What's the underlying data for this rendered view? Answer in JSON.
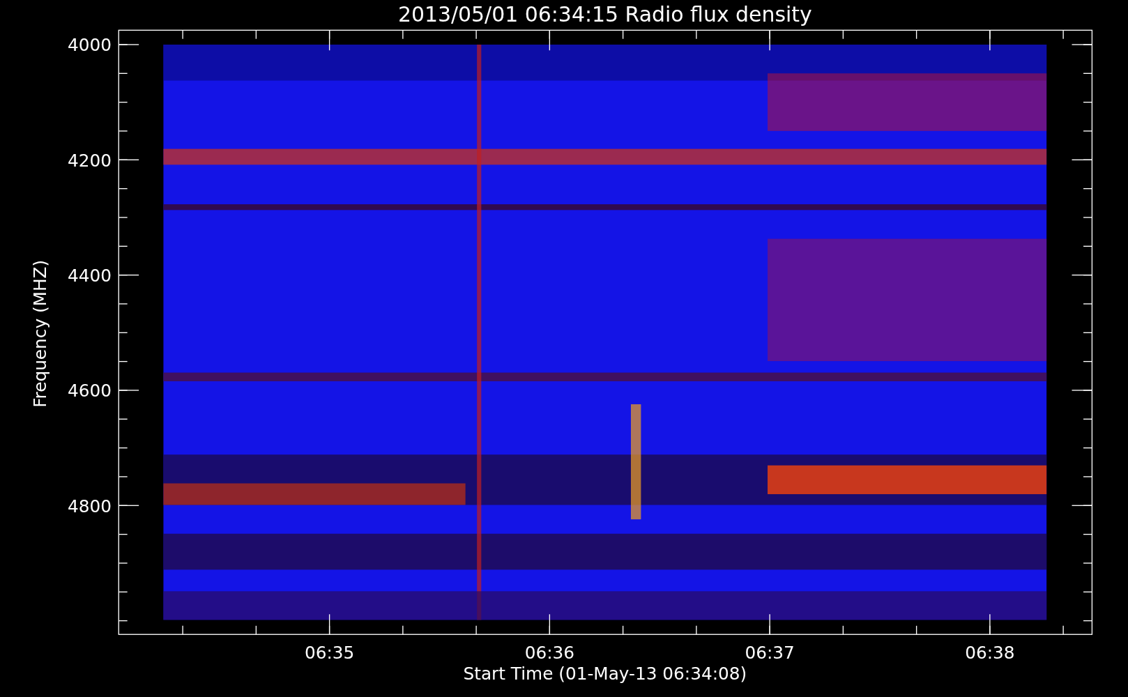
{
  "title": "2013/05/01 06:34:15 Radio flux density",
  "ylabel": "Frequency (MHZ)",
  "xlabel": "Start Time (01-May-13 06:34:08)",
  "yticks": [
    "4000",
    "4200",
    "4400",
    "4600",
    "4800"
  ],
  "xticks": [
    "06:35",
    "06:36",
    "06:37",
    "06:38"
  ]
}
